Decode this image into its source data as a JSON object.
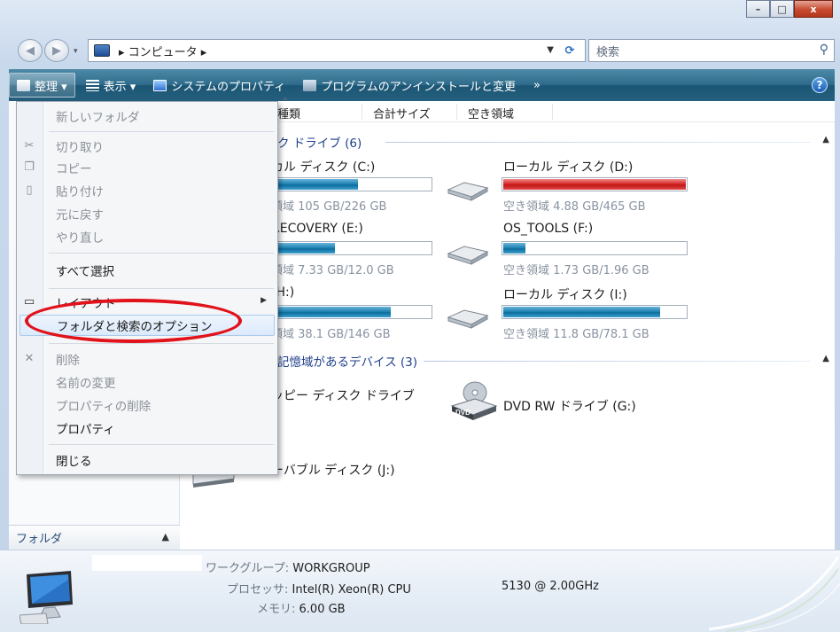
{
  "window": {
    "minimize": "–",
    "maximize": "□",
    "close": "x"
  },
  "address": {
    "crumb": "▸ コンピュータ ▸"
  },
  "search": {
    "placeholder": "検索"
  },
  "toolbar": {
    "organize": "整理 ▾",
    "views": "表示 ▾",
    "system_properties": "システムのプロパティ",
    "uninstall": "プログラムのアンインストールと変更",
    "more": "»",
    "help": "?"
  },
  "columns": {
    "type": "種類",
    "total_size": "合計サイズ",
    "free_space": "空き領域"
  },
  "groups": {
    "hard_disks": "ク ドライブ (6)",
    "removable": "記憶域があるデバイス (3)"
  },
  "drives": [
    {
      "name": "カル ディスク (C:)",
      "free": "領域 105 GB/226 GB",
      "used_fraction": 0.535
    },
    {
      "name": "ローカル ディスク (D:)",
      "free": "空き領域 4.88 GB/465 GB",
      "used_fraction": 0.99
    },
    {
      "name": "RECOVERY (E:)",
      "free": "領域 7.33 GB/12.0 GB",
      "used_fraction": 0.39
    },
    {
      "name": "OS_TOOLS (F:)",
      "free": "空き領域 1.73 GB/1.96 GB",
      "used_fraction": 0.12
    },
    {
      "name": "(H:)",
      "free": "領域 38.1 GB/146 GB",
      "used_fraction": 0.74
    },
    {
      "name": "ローカル ディスク (I:)",
      "free": "空き領域 11.8 GB/78.1 GB",
      "used_fraction": 0.85
    }
  ],
  "devices": {
    "floppy": "ッピー ディスク ドライブ",
    "dvd": "DVD RW ドライブ (G:)",
    "dvd_label": "DVD",
    "removable": "ーバブル ディスク (J:)"
  },
  "menu": {
    "new_folder": "新しいフォルダ",
    "cut": "切り取り",
    "copy": "コピー",
    "paste": "貼り付け",
    "undo": "元に戻す",
    "redo": "やり直し",
    "select_all": "すべて選択",
    "layout": "レイアウト",
    "folder_options": "フォルダと検索のオプション",
    "delete": "削除",
    "rename": "名前の変更",
    "remove_properties": "プロパティの削除",
    "properties": "プロパティ",
    "close": "閉じる"
  },
  "nav": {
    "folders": "フォルダ"
  },
  "details": {
    "workgroup_key": "ワークグループ:",
    "workgroup_val": "WORKGROUP",
    "cpu_key": "プロセッサ:",
    "cpu_val": "Intel(R) Xeon(R) CPU",
    "cpu_val2": "5130  @ 2.00GHz",
    "memory_key": "メモリ:",
    "memory_val": "6.00 GB"
  }
}
